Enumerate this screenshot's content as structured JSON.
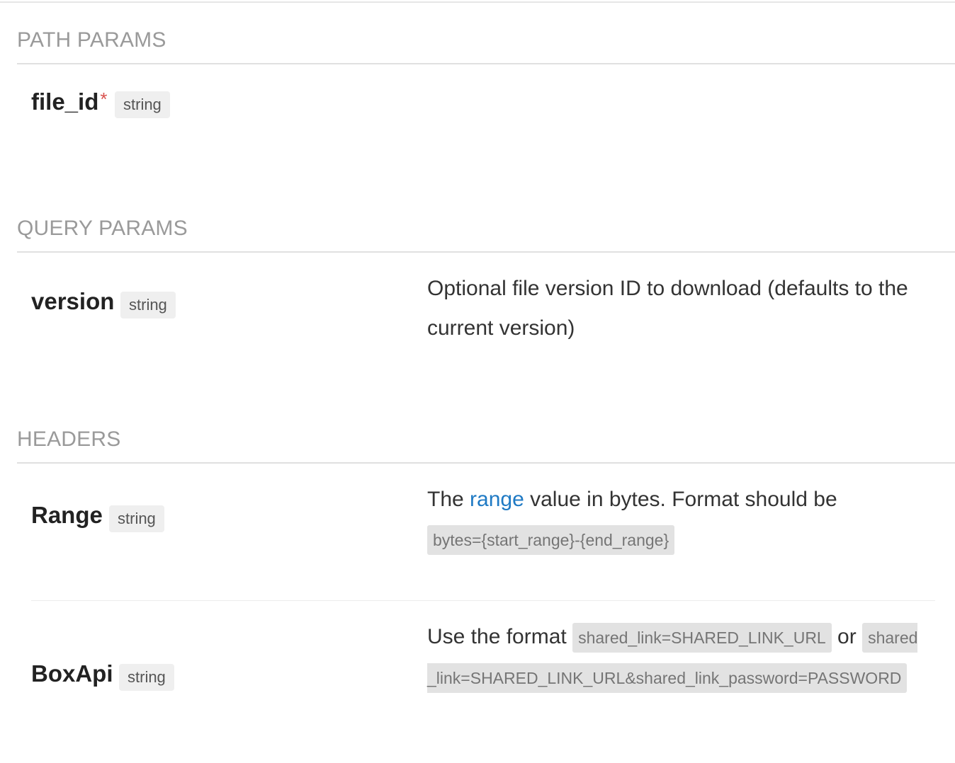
{
  "sections": {
    "path": {
      "title": "PATH PARAMS",
      "params": [
        {
          "name": "file_id",
          "required_mark": "*",
          "type": "string"
        }
      ]
    },
    "query": {
      "title": "QUERY PARAMS",
      "params": [
        {
          "name": "version",
          "type": "string",
          "description": "Optional file version ID to download (defaults to the current version)"
        }
      ]
    },
    "headers": {
      "title": "HEADERS",
      "params": [
        {
          "name": "Range",
          "type": "string",
          "desc_prefix": "The ",
          "desc_link": "range",
          "desc_middle": " value in bytes. Format should be ",
          "desc_code": "bytes={start_range}-{end_range}"
        },
        {
          "name": "BoxApi",
          "type": "string",
          "desc_prefix": "Use the format ",
          "desc_code1": "shared_link=SHARED_LINK_URL",
          "desc_middle": " or ",
          "desc_code2": "shared_link=SHARED_LINK_URL&shared_link_password=PASSWORD"
        }
      ]
    }
  },
  "colors": {
    "link": "#1f7ac4",
    "required": "#d9534f",
    "section_title": "#9a9a9a"
  }
}
